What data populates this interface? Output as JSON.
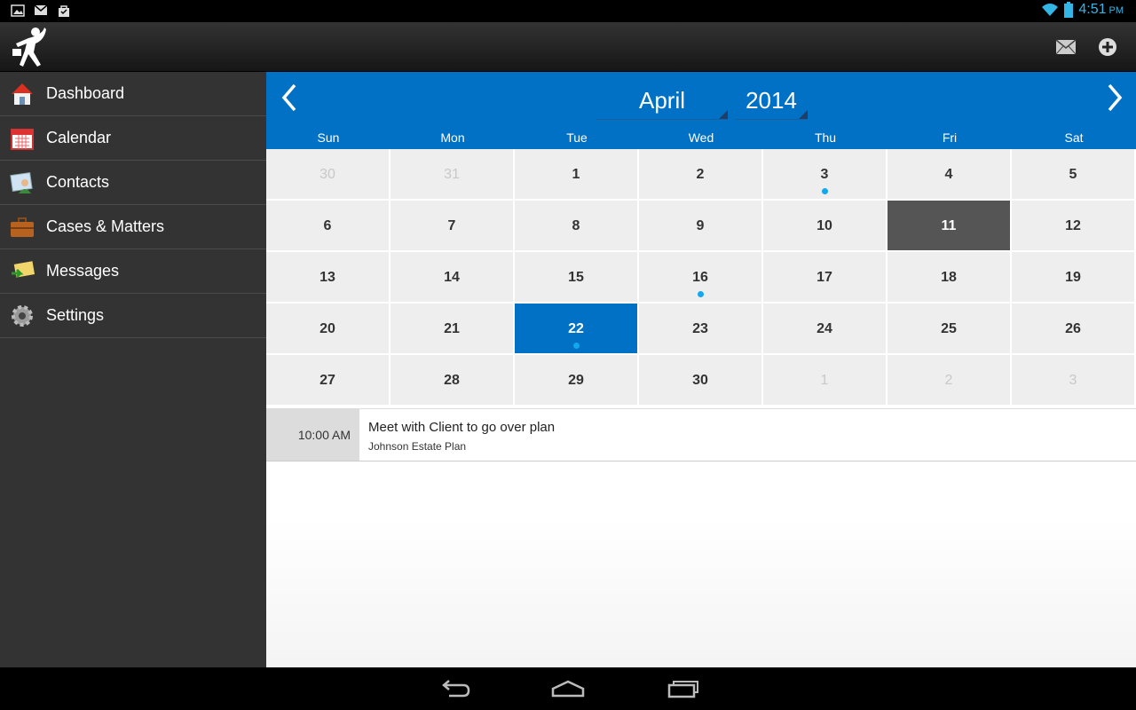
{
  "status_bar": {
    "time": "4:51",
    "ampm": "PM",
    "left_icons": [
      "image-icon",
      "gmail-icon",
      "store-bag-icon"
    ],
    "right_icons": [
      "wifi-icon",
      "battery-icon"
    ]
  },
  "action_bar": {
    "actions": [
      "mail-icon",
      "add-icon"
    ]
  },
  "sidebar": {
    "items": [
      {
        "label": "Dashboard",
        "icon": "home-icon"
      },
      {
        "label": "Calendar",
        "icon": "calendar-icon"
      },
      {
        "label": "Contacts",
        "icon": "contacts-icon"
      },
      {
        "label": "Cases & Matters",
        "icon": "briefcase-icon"
      },
      {
        "label": "Messages",
        "icon": "messages-icon"
      },
      {
        "label": "Settings",
        "icon": "gear-icon"
      }
    ]
  },
  "calendar": {
    "month": "April",
    "year": "2014",
    "weekdays": [
      "Sun",
      "Mon",
      "Tue",
      "Wed",
      "Thu",
      "Fri",
      "Sat"
    ],
    "days": [
      {
        "d": "30",
        "other": true
      },
      {
        "d": "31",
        "other": true
      },
      {
        "d": "1"
      },
      {
        "d": "2"
      },
      {
        "d": "3",
        "dot": true
      },
      {
        "d": "4"
      },
      {
        "d": "5"
      },
      {
        "d": "6"
      },
      {
        "d": "7"
      },
      {
        "d": "8"
      },
      {
        "d": "9"
      },
      {
        "d": "10"
      },
      {
        "d": "11",
        "today": true
      },
      {
        "d": "12"
      },
      {
        "d": "13"
      },
      {
        "d": "14"
      },
      {
        "d": "15"
      },
      {
        "d": "16",
        "dot": true
      },
      {
        "d": "17"
      },
      {
        "d": "18"
      },
      {
        "d": "19"
      },
      {
        "d": "20"
      },
      {
        "d": "21"
      },
      {
        "d": "22",
        "selected": true,
        "dot": true
      },
      {
        "d": "23"
      },
      {
        "d": "24"
      },
      {
        "d": "25"
      },
      {
        "d": "26"
      },
      {
        "d": "27"
      },
      {
        "d": "28"
      },
      {
        "d": "29"
      },
      {
        "d": "30"
      },
      {
        "d": "1",
        "other": true
      },
      {
        "d": "2",
        "other": true
      },
      {
        "d": "3",
        "other": true
      }
    ]
  },
  "events": [
    {
      "time": "10:00 AM",
      "title": "Meet with Client to go over plan",
      "subtitle": "Johnson Estate Plan"
    }
  ],
  "colors": {
    "accent": "#0071c5",
    "today": "#555555",
    "event_dot": "#12a8f0",
    "status_icons": "#33b5e5"
  }
}
